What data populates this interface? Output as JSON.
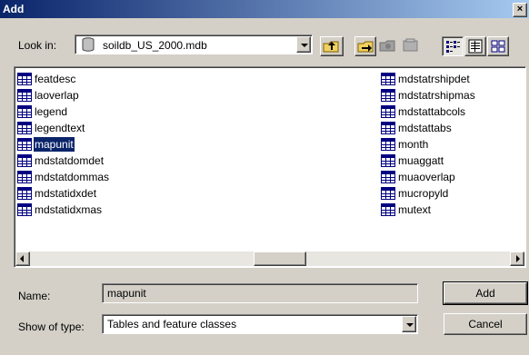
{
  "window": {
    "title": "Add",
    "close_glyph": "×"
  },
  "lookin": {
    "label": "Look in:",
    "value": "soildb_US_2000.mdb",
    "icon": "database-drive-icon"
  },
  "toolbar": {
    "buttons": [
      "up-one-level-icon",
      "connect-folder-icon",
      "disconnect-folder-icon",
      "properties-icon",
      "list-view-icon",
      "details-view-icon",
      "thumbnails-view-icon"
    ]
  },
  "files": {
    "col1": [
      "featdesc",
      "laoverlap",
      "legend",
      "legendtext",
      "mapunit",
      "mdstatdomdet",
      "mdstatdommas",
      "mdstatidxdet",
      "mdstatidxmas"
    ],
    "col2": [
      "mdstatrshipdet",
      "mdstatrshipmas",
      "mdstattabcols",
      "mdstattabs",
      "month",
      "muaggatt",
      "muaoverlap",
      "mucropyld",
      "mutext"
    ],
    "selected": "mapunit"
  },
  "name": {
    "label": "Name:",
    "value": "mapunit"
  },
  "type": {
    "label": "Show of type:",
    "value": "Tables and feature classes"
  },
  "buttons": {
    "add": "Add",
    "cancel": "Cancel"
  }
}
